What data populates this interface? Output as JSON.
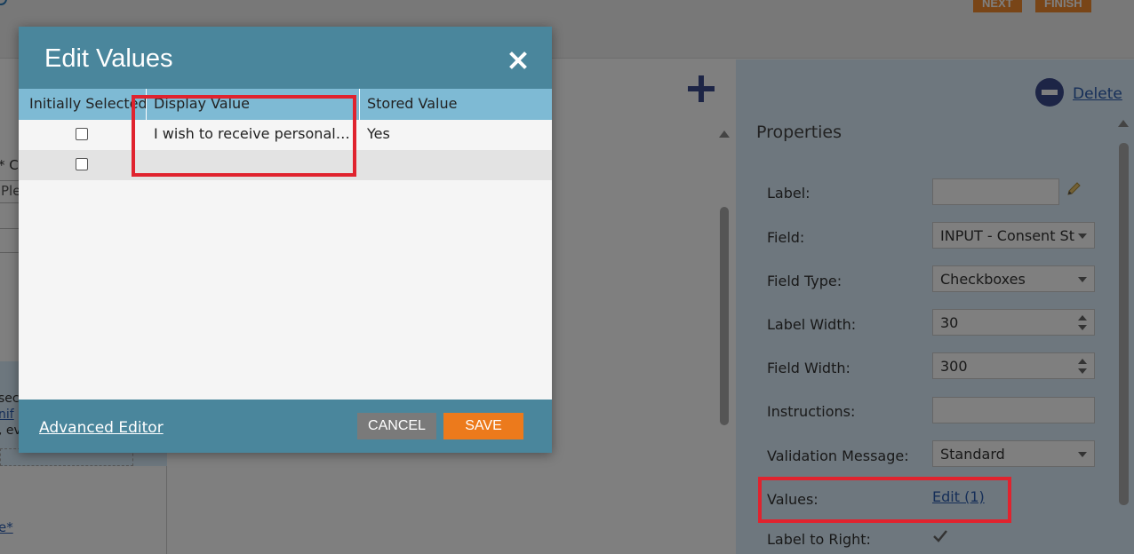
{
  "topbar": {
    "next_label": "NEXT",
    "finish_label": "FINISH"
  },
  "left_panel": {
    "text_c": "* C",
    "input_placeholder": "Ple",
    "box_lines": [
      "sec",
      "nif",
      ", ev"
    ],
    "bottom_link": "e*"
  },
  "right_panel": {
    "delete_label": "Delete",
    "properties_title": "Properties",
    "label_label": "Label:",
    "label_value": "",
    "field_label": "Field:",
    "field_value": "INPUT - Consent St",
    "field_type_label": "Field Type:",
    "field_type_value": "Checkboxes",
    "label_width_label": "Label Width:",
    "label_width_value": "30",
    "field_width_label": "Field Width:",
    "field_width_value": "300",
    "instructions_label": "Instructions:",
    "instructions_value": "",
    "validation_label": "Validation Message:",
    "validation_value": "Standard",
    "values_label": "Values:",
    "values_link": "Edit (1)",
    "label_to_right_label": "Label to Right:"
  },
  "modal": {
    "title": "Edit Values",
    "columns": [
      "Initially Selected",
      "Display Value",
      "Stored Value"
    ],
    "rows": [
      {
        "selected": false,
        "display": "I wish to receive personalised content",
        "stored": "Yes"
      },
      {
        "selected": false,
        "display": "",
        "stored": ""
      }
    ],
    "advanced_editor": "Advanced Editor",
    "cancel_label": "CANCEL",
    "save_label": "SAVE"
  },
  "colors": {
    "modal_header": "#4a869c",
    "grid_header": "#7ebad4",
    "save_button": "#ec7a1c",
    "cancel_button": "#7a7a7a",
    "highlight": "#e0232e"
  }
}
